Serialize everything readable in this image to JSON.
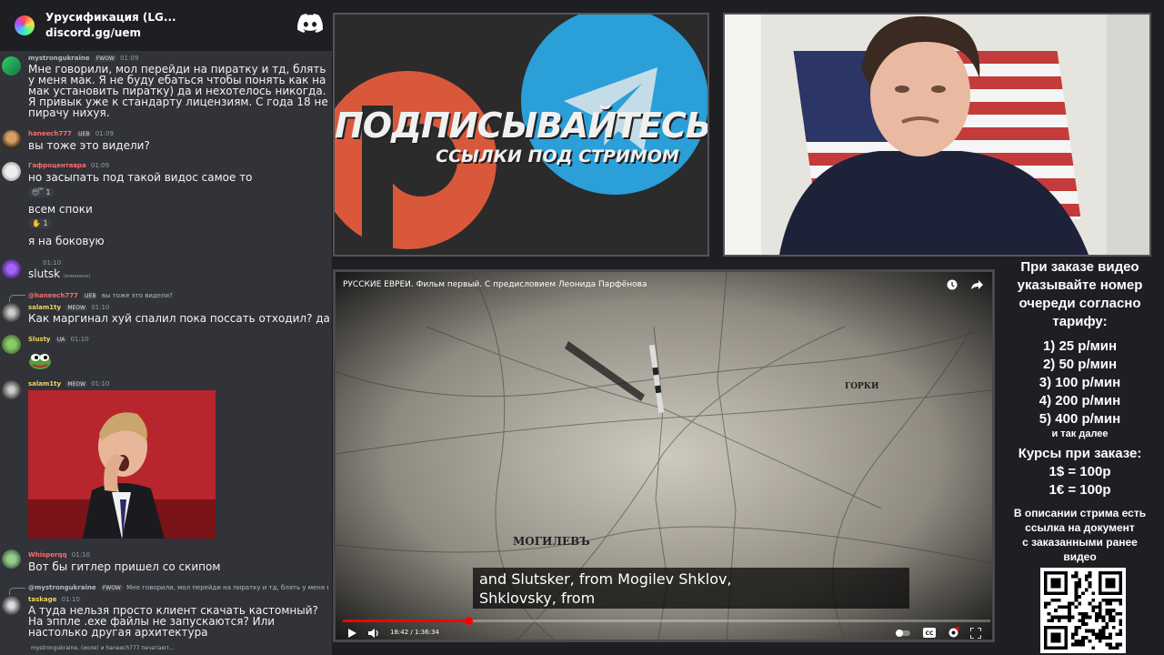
{
  "server": {
    "name": "Урусификация (LG...",
    "invite": "discord.gg/uem"
  },
  "messages": [
    {
      "user": "mystrongukraine",
      "badge": "FWOW",
      "time": "01:09",
      "color": "#b5bac1",
      "text": "Мне говорили, мол перейди на пиратку и тд, блять у меня мак. Я не буду ебаться чтобы понять как на мак установить пиратку) да и нехотелось никогда. Я привык уже к стандарту лицензиям. С года 18 не пирачу нихуя."
    },
    {
      "user": "haneech777",
      "badge": "UEB",
      "time": "01:09",
      "color": "#ff6b6b",
      "text": "вы тоже это видели?"
    },
    {
      "user": "Гафроцентавра",
      "badge": "",
      "time": "01:09",
      "color": "#ff6b6b",
      "text": "но засыпать под такой видос самое то"
    },
    {
      "text": "всем споки"
    },
    {
      "text": "я на боковую"
    },
    {
      "user": "",
      "badge": "",
      "time": "01:10",
      "color": "#b5bac1",
      "text": "slutsk",
      "edited": "(изменено)"
    },
    {
      "user": "haneech777",
      "badge": "UEB",
      "time": "01:10",
      "color": "#ff6b6b",
      "text": "Как маргинал хуй спалил пока поссать отходил? да",
      "reply": "вы тоже это видели?",
      "reply_user": "@haneech777",
      "reply_badge": "UEB"
    },
    {
      "user": "Slusty",
      "badge": "UA",
      "time": "01:10",
      "color": "#f2d45c"
    },
    {
      "user": "salam1ty",
      "badge": "MEOW",
      "time": "01:10",
      "color": "#f2d45c"
    },
    {
      "user": "Whisperqq",
      "badge": "",
      "time": "01:10",
      "color": "#ff6b6b",
      "text": "Вот бы гитлер пришел со скипом"
    },
    {
      "user": "taskage",
      "badge": "",
      "time": "01:10",
      "color": "#f2d45c",
      "text": "А туда нельзя просто клиент скачать кастомный? На эппле .exe файлы не запускаются? Или настолько другая архитектура",
      "reply": "Мне говорили, мол перейди на пиратку и тд, блять у меня мак. Я не",
      "reply_user": "@mystrongukraine",
      "reply_badge": "FWOW"
    }
  ],
  "reactions": {
    "r1": "1",
    "r2": "1"
  },
  "typing": "mystrongukraine, (иоле) и haneech777 печатают...",
  "promo": {
    "title": "ПОДПИСЫВАЙТЕСЬ",
    "subtitle": "ССЫЛКИ ПОД СТРИМОМ",
    "colors": {
      "patreon": "#d9583b",
      "telegram": "#2a9fd8"
    }
  },
  "video": {
    "title": "РУССКИЕ ЕВРЕИ. Фильм первый. С предисловием Леонида Парфёнова",
    "subtitle_line1": "and Slutsker, from Mogilev Shklov,",
    "subtitle_line2": "Shklovsky, from",
    "time": "18:42 / 1:36:34",
    "progress": 0.194,
    "map_labels": {
      "city": "МОГИЛЕВЪ",
      "town": "ГОРКИ"
    }
  },
  "info": {
    "intro": [
      "При заказе видео",
      "указывайте номер",
      "очереди согласно",
      "тарифу:"
    ],
    "tariffs": [
      "1) 25 р/мин",
      "2) 50 р/мин",
      "3) 100 р/мин",
      "4) 200 р/мин",
      "5) 400 р/мин"
    ],
    "etc": "и так далее",
    "rates_title": "Курсы при заказе:",
    "rates": [
      "1$ = 100р",
      "1€ = 100р"
    ],
    "desc": [
      "В описании стрима есть",
      "ссылка на документ",
      "с заказанными ранее",
      "видео"
    ]
  }
}
